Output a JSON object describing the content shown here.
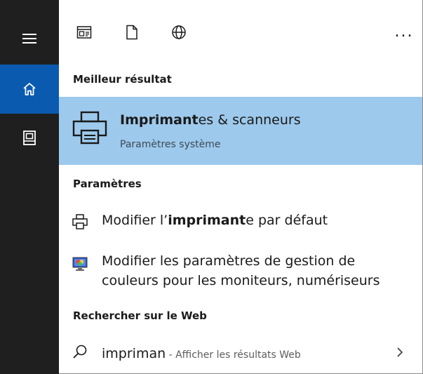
{
  "toolbar": {
    "more_label": "..."
  },
  "rail": {
    "items": [
      {
        "icon": "hamburger-menu-icon"
      },
      {
        "icon": "home-icon",
        "selected": true
      },
      {
        "icon": "documents-icon"
      }
    ]
  },
  "sections": {
    "best_result": "Meilleur résultat",
    "settings": "Paramètres",
    "web": "Rechercher sur le Web"
  },
  "best_result": {
    "title_bold": "Imprimant",
    "title_rest": "es & scanneurs",
    "subtitle": "Paramètres système",
    "icon": "printer-icon"
  },
  "settings_items": [
    {
      "label_before": "Modifier l’",
      "label_bold": "imprimant",
      "label_after": "e par défaut",
      "icon": "printer-icon"
    },
    {
      "label": "Modifier les paramètres de gestion de couleurs pour les moniteurs, numériseurs",
      "icon": "color-management-icon"
    }
  ],
  "web_item": {
    "query": "impriman",
    "hint": " - Afficher les résultats Web",
    "icon": "search-icon"
  },
  "colors": {
    "rail_background": "#1f1f1f",
    "rail_selected": "#0a5bb0",
    "highlight": "#9dc9ec"
  }
}
